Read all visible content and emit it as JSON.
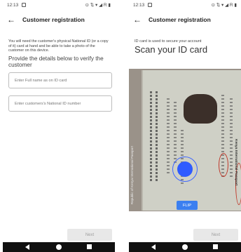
{
  "status": {
    "time": "12:13",
    "right_icons": "⊙ ⇅ ▾ ◢ R ▮"
  },
  "left_screen": {
    "header_title": "Customer registration",
    "intro_text": "You will need the customer's physical National ID (or a copy of it) card at hand and be able to take a photo of the customer on this device.",
    "section_heading": "Provide the details below to verify the customer",
    "name_placeholder": "Enter Full name as on ID card",
    "id_placeholder": "Enter customers's National ID number",
    "next_label": "Next"
  },
  "right_screen": {
    "header_title": "Customer registration",
    "subtitle": "ID card is used to secure your account",
    "title": "Scan your ID card",
    "flip_label": "FLIP",
    "next_label": "Next",
    "side_text_left": "Republic of Kenya International Passport",
    "side_text_right": "Kenya International Passport"
  },
  "icons": {
    "back": "back-arrow-icon",
    "nav_back": "nav-back-icon",
    "nav_home": "nav-home-icon",
    "nav_recent": "nav-recent-icon"
  },
  "colors": {
    "flip_button": "#3b7ff0",
    "focus_indicator": "#2f5bff",
    "next_disabled_bg": "#e8e8e8",
    "highlight_oval": "#c0392b"
  }
}
